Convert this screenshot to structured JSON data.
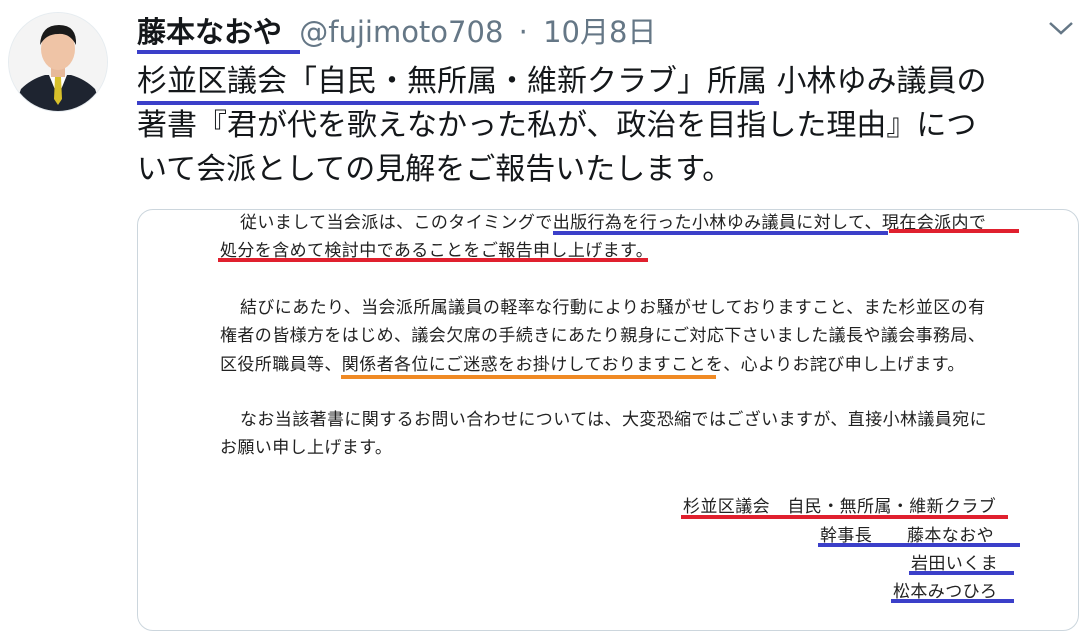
{
  "tweet": {
    "author_name": "藤本なおや",
    "handle": "@fujimoto708",
    "separator": "·",
    "date": "10月8日",
    "text_line1": "杉並区議会「自民・無所属・維新クラブ」所属 小林ゆみ議員の",
    "text_line2": "著書『君が代を歌えなかった私が、政治を目指した理由』につ",
    "text_line3": "いて会派としての見解をご報告いたします。"
  },
  "icons": {
    "avatar": "profile-photo",
    "caret": "chevron-down-icon"
  },
  "colors": {
    "blue_underline": "#3b3fc9",
    "red_underline": "#e0202e",
    "orange_underline": "#f08a24",
    "meta_gray": "#657786"
  },
  "document": {
    "p1_line1": "従いまして当会派は、このタイミングで出版行為を行った小林ゆみ議員に対して、現在会派内で",
    "p1_line2": "処分を含めて検討中であることをご報告申し上げます。",
    "p2_line1": "結びにあたり、当会派所属議員の軽率な行動によりお騒がせしておりますこと、また杉並区の有",
    "p2_line2": "権者の皆様方をはじめ、議会欠席の手続きにあたり親身にご対応下さいました議長や議会事務局、",
    "p2_line3": "区役所職員等、関係者各位にご迷惑をお掛けしておりますことを、心よりお詫び申し上げます。",
    "p3_line1": "なお当該著書に関するお問い合わせについては、大変恐縮ではございますが、直接小林議員宛に",
    "p3_line2": "お願い申し上げます。",
    "sig_group": "杉並区議会　自民・無所属・維新クラブ",
    "sig_role": "幹事長　　藤本なおや",
    "sig_member1": "岩田いくま",
    "sig_member2": "松本みつひろ"
  }
}
